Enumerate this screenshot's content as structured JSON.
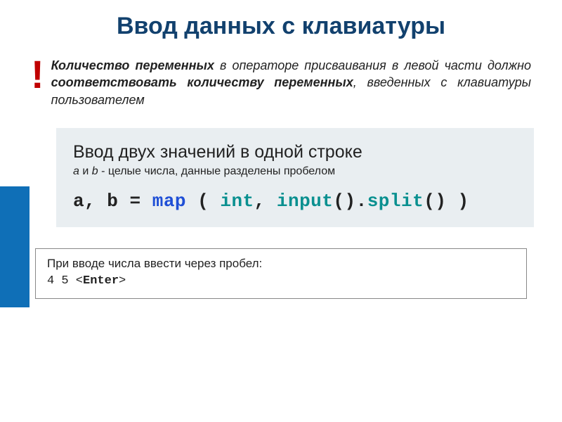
{
  "title": "Ввод данных с клавиатуры",
  "bang": "!",
  "warning": {
    "p1a": "Количество переменных",
    "p1b": " в операторе присваивания в левой части должно ",
    "p1c": "соответствовать количеству переменных",
    "p1d": ", введенных с клавиатуры пользователем"
  },
  "codebox": {
    "heading": "Ввод двух значений в одной строке",
    "sub_a": "a",
    "sub_and": " и ",
    "sub_b": "b",
    "sub_rest": " - целые числа, данные разделены пробелом",
    "code": {
      "lhs": "a, b = ",
      "map": "map",
      "paren1": " ( ",
      "int": "int",
      "comma": ", ",
      "input": "input",
      "call1": "().",
      "split": "split",
      "call2": "() )"
    }
  },
  "note": {
    "line1": "При вводе числа ввести через пробел:",
    "line2a": "4 5 <",
    "line2b": "Enter",
    "line2c": ">"
  }
}
